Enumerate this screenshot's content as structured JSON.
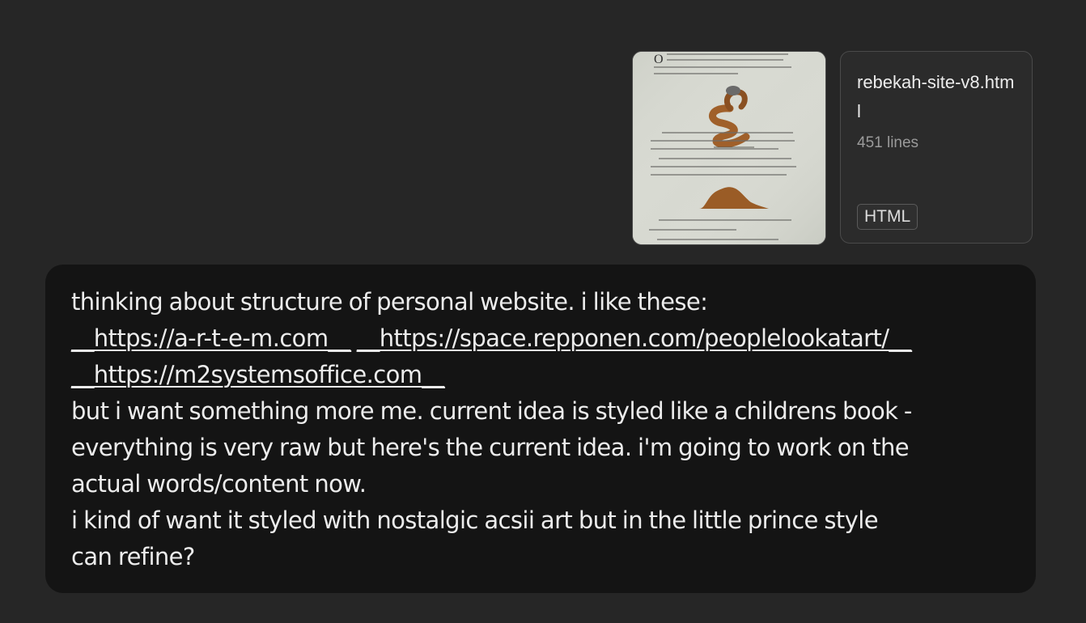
{
  "attachments": {
    "file": {
      "name": "rebekah-site-v8.html",
      "lines": "451 lines",
      "type": "HTML"
    }
  },
  "message": {
    "intro": "thinking about structure of personal website. i like these:",
    "links": [
      "__https://a-r-t-e-m.com__",
      "__https://space.repponen.com/peoplelookatart/__",
      "__https://m2systemsoffice.com__"
    ],
    "paragraph": [
      "but i want something more me. current idea is styled like a childrens book -",
      "everything is very raw but here's the current idea. i'm going to work on the",
      "actual words/content now.",
      "i kind of want it styled with nostalgic acsii art but in the little prince style",
      "can refine?"
    ]
  }
}
